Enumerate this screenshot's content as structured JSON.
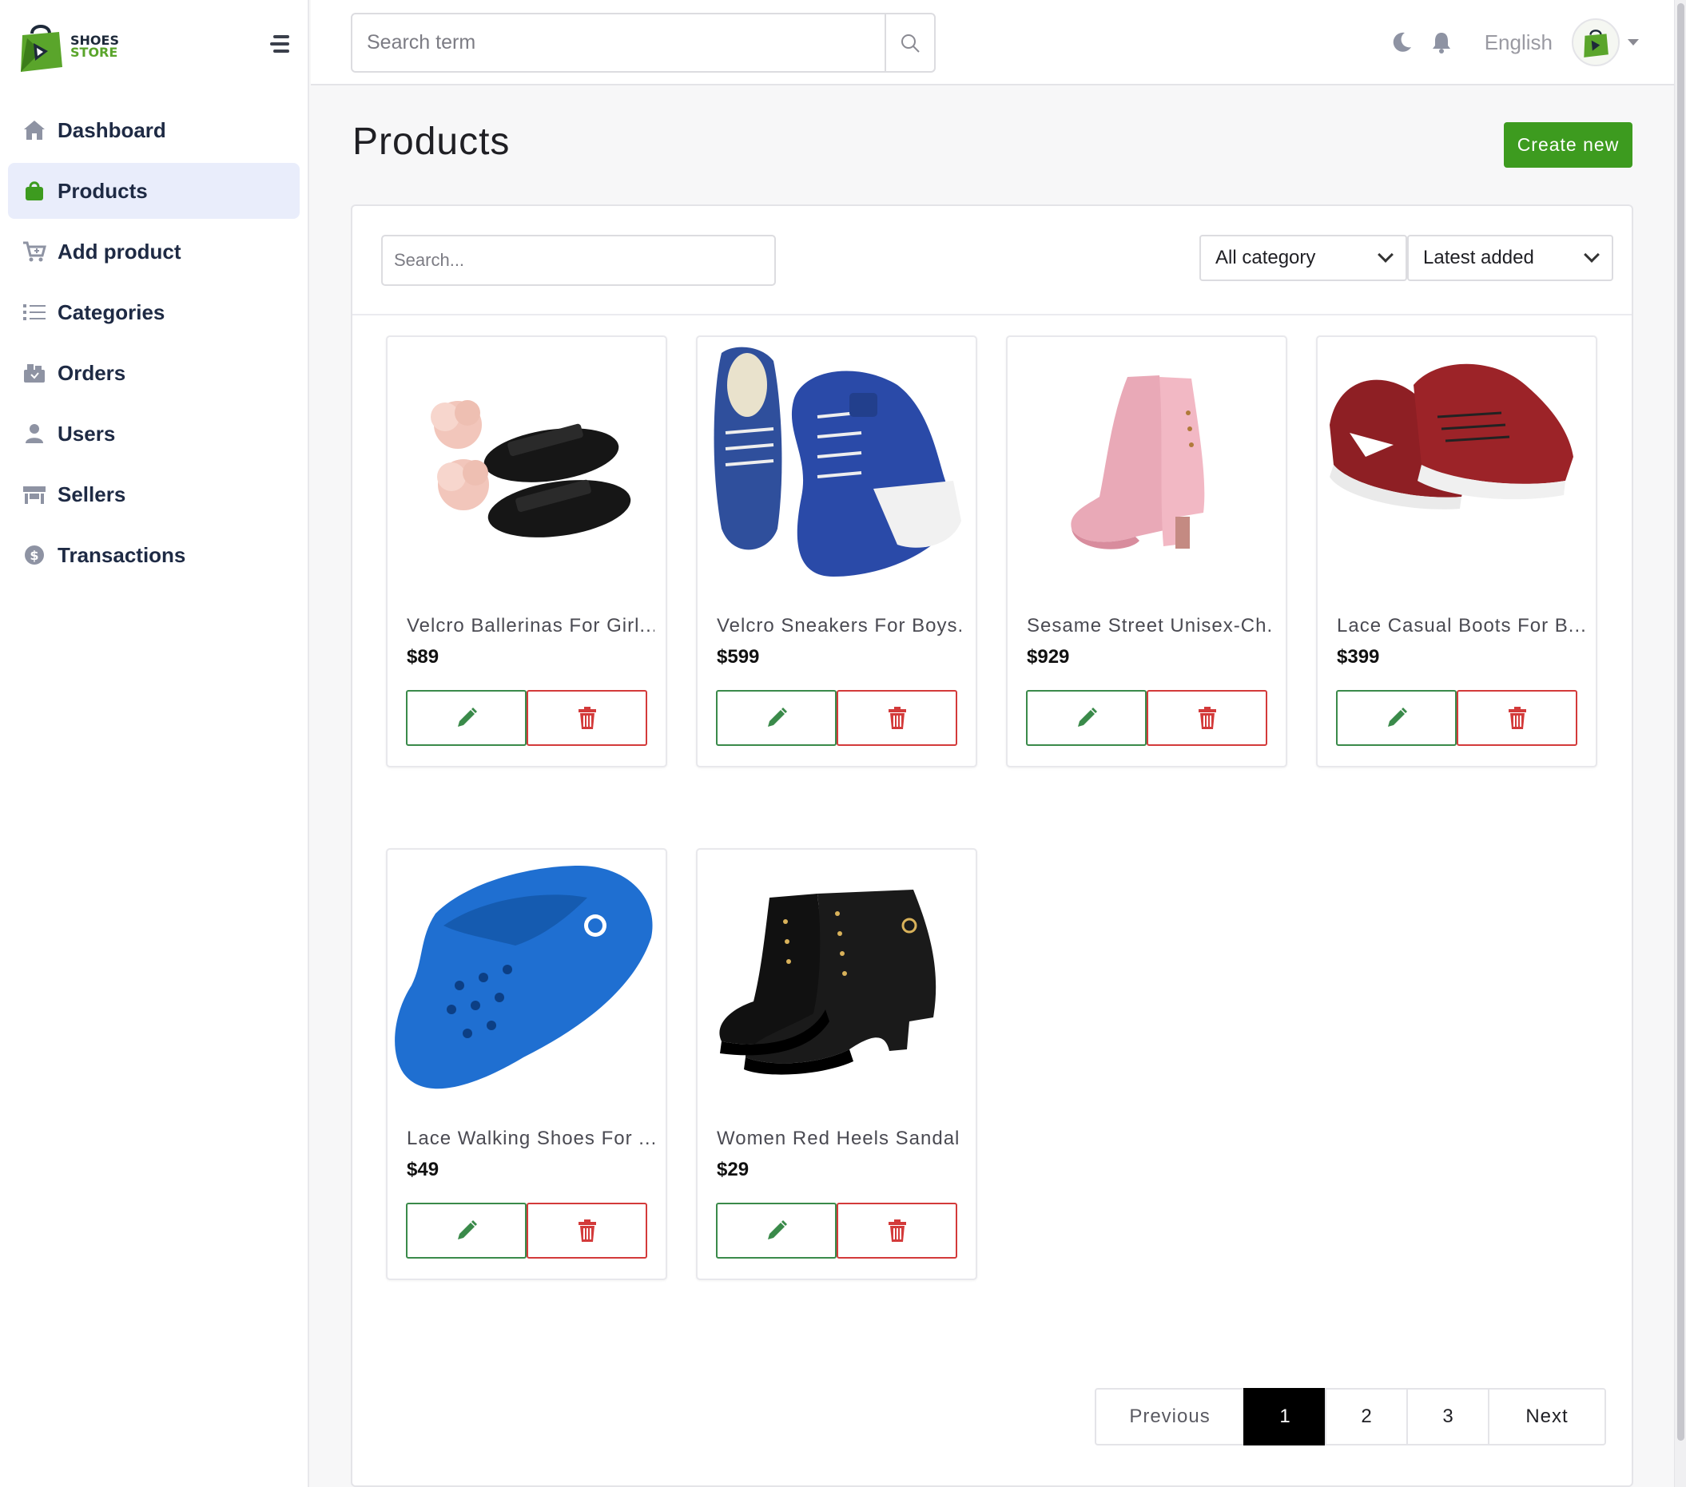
{
  "brand": {
    "line1": "SHOES",
    "line2": "STORE",
    "accent": "#5aa52b"
  },
  "sidebar": {
    "items": [
      {
        "label": "Dashboard",
        "icon": "home-icon",
        "active": false
      },
      {
        "label": "Products",
        "icon": "shopping-bag-icon",
        "active": true
      },
      {
        "label": "Add product",
        "icon": "cart-plus-icon",
        "active": false
      },
      {
        "label": "Categories",
        "icon": "list-icon",
        "active": false
      },
      {
        "label": "Orders",
        "icon": "orders-icon",
        "active": false
      },
      {
        "label": "Users",
        "icon": "user-icon",
        "active": false
      },
      {
        "label": "Sellers",
        "icon": "store-icon",
        "active": false
      },
      {
        "label": "Transactions",
        "icon": "dollar-circle-icon",
        "active": false
      }
    ]
  },
  "header": {
    "search_placeholder": "Search term",
    "language": "English"
  },
  "main": {
    "title": "Products",
    "create_label": "Create new",
    "filter_search_placeholder": "Search...",
    "category_select": "All category",
    "sort_select": "Latest added"
  },
  "products": [
    {
      "name": "Velcro Ballerinas For Girl...",
      "price": "$89",
      "image": "black-flower-slides"
    },
    {
      "name": "Velcro Sneakers For Boys...",
      "price": "$599",
      "image": "blue-denim-heel-boots"
    },
    {
      "name": "Sesame Street Unisex-Ch...",
      "price": "$929",
      "image": "pink-heel-ankle-boots"
    },
    {
      "name": "Lace Casual Boots For B...",
      "price": "$399",
      "image": "maroon-running-shoes"
    },
    {
      "name": "Lace Walking Shoes For ...",
      "price": "$49",
      "image": "blue-clog"
    },
    {
      "name": "Women Red Heels Sandal",
      "price": "$29",
      "image": "black-lace-up-heel-boots"
    }
  ],
  "pagination": {
    "previous": "Previous",
    "pages": [
      "1",
      "2",
      "3"
    ],
    "current": "1",
    "next": "Next"
  },
  "colors": {
    "primary_green": "#3d9b1f",
    "edit": "#3a8a4a",
    "delete": "#d33a3a",
    "active_nav_bg": "#e9edfb"
  }
}
